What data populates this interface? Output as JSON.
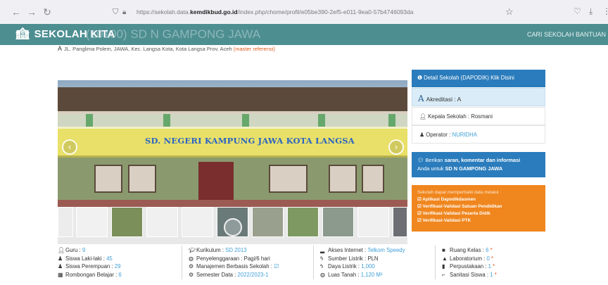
{
  "browser": {
    "url_prefix": "https://sekolah.data.",
    "url_domain": "kemdikbud.go.id",
    "url_suffix": "/index.php/chome/profil/e05be390-2ef5-e011-9ea0-57b4746093da"
  },
  "header": {
    "logo": "SEKOLAH KITA",
    "page_title": "(10100) SD N GAMPONG JAWA",
    "nav": [
      "CARI SEKOLAH",
      "BANTUAN"
    ]
  },
  "address": {
    "text": "JL. Panglima Polem, JAWA, Kec. Langsa Kota, Kota Langsa Prov. Aceh",
    "master": "(master referensi)"
  },
  "photo": {
    "sign_text": "SD. NEGERI KAMPUNG JAWA KOTA LANGSA"
  },
  "panel": {
    "detail_label": "Detail Sekolah (DAPODIK)",
    "detail_link": "Klik Disini",
    "akreditasi_label": "Akreditasi :",
    "akreditasi_value": "A",
    "kepala_label": "Kepala Sekolah :",
    "kepala_value": "Rosmani",
    "operator_label": "Operator :",
    "operator_value": "NURIDHA",
    "comment_pre": "Berikan",
    "comment_bold": "saran, komentar dan informasi",
    "comment_line2_pre": "Anda untuk",
    "comment_line2_bold": "SD N GAMPONG JAWA",
    "orange_title": "Sekolah dapat memperbaiki data melalui :",
    "orange_links": [
      "Aplikasi Dapodikdasmen",
      "Verifikasi-Validasi Satuan Pendidikan",
      "Verifikasi-Validasi Peserta Didik",
      "Verifikasi-Validasi PTK"
    ]
  },
  "stats": {
    "col1": [
      {
        "icon": "user-icon",
        "label": "Guru :",
        "value": "9"
      },
      {
        "icon": "male-icon",
        "label": "Siswa Laki-laki :",
        "value": "45"
      },
      {
        "icon": "female-icon",
        "label": "Siswa Perempuan :",
        "value": "29"
      },
      {
        "icon": "table-icon",
        "label": "Rombongan Belajar :",
        "value": "6"
      }
    ],
    "col2": [
      {
        "icon": "graduation-cap-icon",
        "label": "Kurikulum :",
        "value": "SD 2013"
      },
      {
        "icon": "globe-icon",
        "label": "Penyelenggaraan :",
        "value": "Pagi/6 hari"
      },
      {
        "icon": "gear-icon",
        "label": "Manajemen Berbasis Sekolah :",
        "value": "☑"
      },
      {
        "icon": "gear-icon",
        "label": "Semester Data :",
        "value": "2022/2023-1"
      }
    ],
    "col3": [
      {
        "icon": "signal-icon",
        "label": "Akses Internet :",
        "value": "Telkom Speedy"
      },
      {
        "icon": "bolt-icon",
        "label": "Sumber Listrik :",
        "value": "PLN"
      },
      {
        "icon": "bolt-icon",
        "label": "Daya Listrik :",
        "value": "1,000"
      },
      {
        "icon": "globe-icon",
        "label": "Luas Tanah :",
        "value": "1,120 M²"
      }
    ],
    "col4": [
      {
        "icon": "square-icon",
        "label": "Ruang Kelas :",
        "value": "6"
      },
      {
        "icon": "flask-icon",
        "label": "Laboratorium :",
        "value": "0"
      },
      {
        "icon": "book-icon",
        "label": "Perpustakaan :",
        "value": "1"
      },
      {
        "icon": "shower-icon",
        "label": "Sanitasi Siswa :",
        "value": "1"
      }
    ]
  }
}
